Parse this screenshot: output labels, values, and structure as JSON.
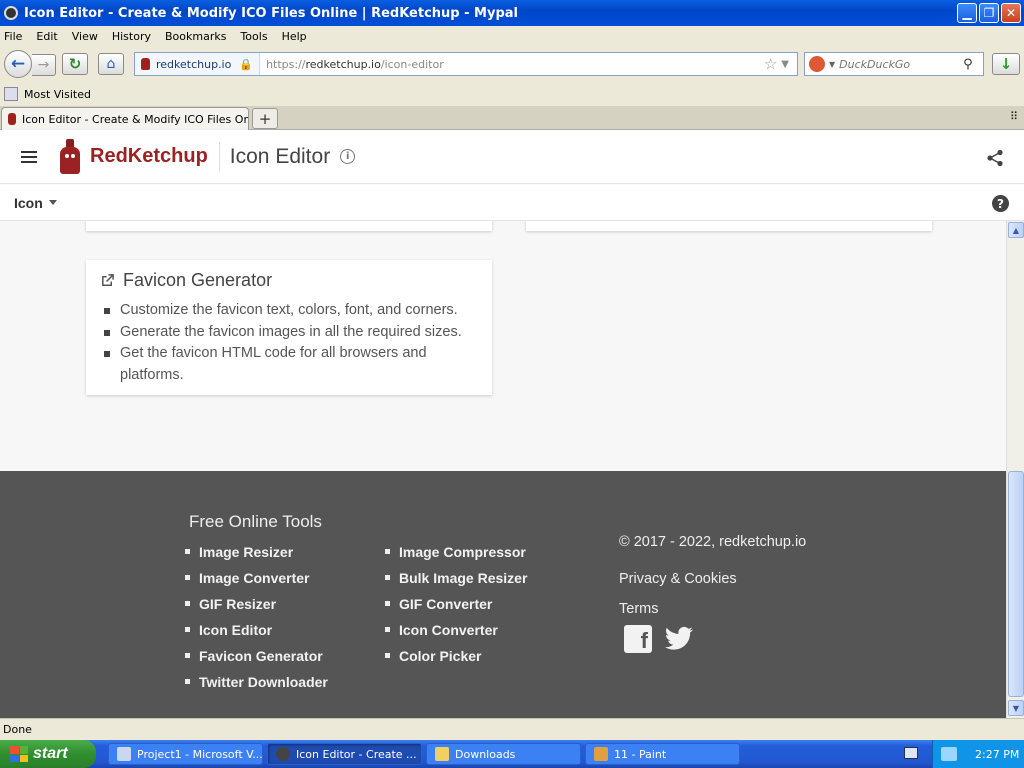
{
  "window": {
    "title": "Icon Editor - Create & Modify ICO Files Online | RedKetchup - Mypal"
  },
  "menubar": [
    "File",
    "Edit",
    "View",
    "History",
    "Bookmarks",
    "Tools",
    "Help"
  ],
  "navbar": {
    "site_identity": "redketchup.io",
    "url_prefix": "https://",
    "url_host": "redketchup.io",
    "url_path": "/icon-editor",
    "search_placeholder": "DuckDuckGo"
  },
  "bookmarks": {
    "item": "Most Visited"
  },
  "tabs": {
    "active_label": "Icon Editor - Create & Modify ICO Files Onlin...",
    "new_tab": "+",
    "list_glyph": "⠿"
  },
  "app": {
    "brand": "RedKetchup",
    "title": "Icon Editor",
    "menu_label": "Icon"
  },
  "favicon_card": {
    "title": "Favicon Generator",
    "bullets": [
      "Customize the favicon text, colors, font, and corners.",
      "Generate the favicon images in all the required sizes.",
      "Get the favicon HTML code for all browsers and platforms."
    ]
  },
  "footer": {
    "heading": "Free Online Tools",
    "col1": [
      "Image Resizer",
      "Image Converter",
      "GIF Resizer",
      "Icon Editor",
      "Favicon Generator",
      "Twitter Downloader"
    ],
    "col2": [
      "Image Compressor",
      "Bulk Image Resizer",
      "GIF Converter",
      "Icon Converter",
      "Color Picker"
    ],
    "copyright": "© 2017 - 2022, redketchup.io",
    "privacy": "Privacy & Cookies",
    "terms": "Terms"
  },
  "status": {
    "text": "Done"
  },
  "taskbar": {
    "start": "start",
    "tasks": [
      "Project1 - Microsoft V...",
      "Icon Editor - Create ...",
      "Downloads",
      "11 - Paint"
    ],
    "clock": "2:27 PM"
  },
  "colors": {
    "brand_red": "#9b2222",
    "footer_bg": "#555555",
    "xp_blue": "#245edb",
    "start_green": "#2f8f2f"
  }
}
